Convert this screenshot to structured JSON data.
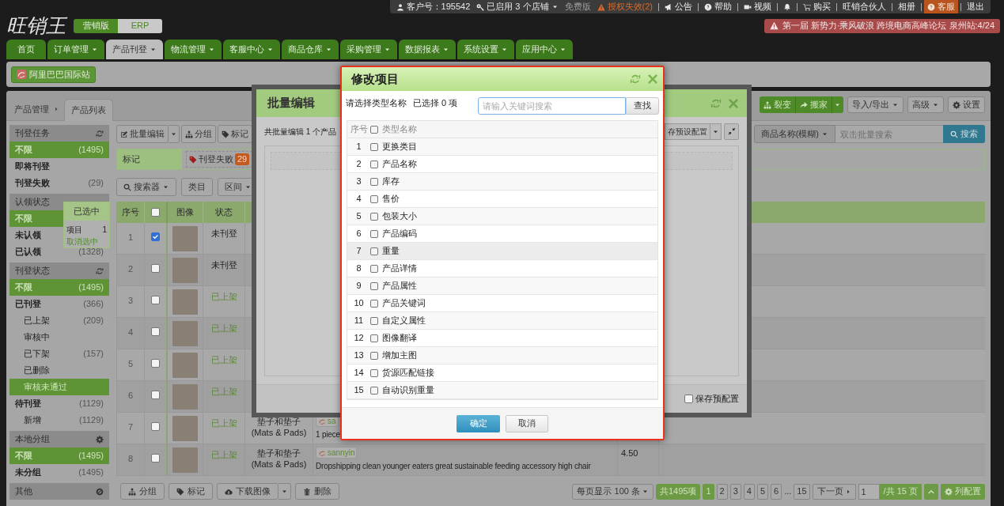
{
  "top_bar": [
    {
      "kind": "customer",
      "text": "客户号：195542"
    },
    {
      "kind": "stores",
      "text": "已启用 3 个店铺"
    },
    {
      "kind": "plan",
      "text": "免费版"
    },
    {
      "kind": "license",
      "text": "授权失效(2)"
    },
    {
      "kind": "notice",
      "text": "公告"
    },
    {
      "kind": "help",
      "text": "帮助"
    },
    {
      "kind": "video",
      "text": "视频"
    },
    {
      "kind": "alerts"
    },
    {
      "kind": "buy",
      "text": "购买"
    },
    {
      "kind": "link",
      "text": "旺销合伙人"
    },
    {
      "kind": "link",
      "text": "相册"
    },
    {
      "kind": "support",
      "text": "客服"
    },
    {
      "kind": "link",
      "text": "退出"
    }
  ],
  "logo": {
    "text": "旺销王"
  },
  "edition_toggle": [
    {
      "label": "营销版",
      "selected": true
    },
    {
      "label": "ERP",
      "selected": false
    }
  ],
  "banner": {
    "text": "第一届 新势力·乘风破浪 跨境电商高峰论坛 泉州站:4/24"
  },
  "nav_tabs": [
    {
      "label": "首页",
      "dropdown": false,
      "selected": false
    },
    {
      "label": "订单管理",
      "dropdown": true,
      "selected": false
    },
    {
      "label": "产品刊登",
      "dropdown": true,
      "selected": true
    },
    {
      "label": "物流管理",
      "dropdown": true,
      "selected": false
    },
    {
      "label": "客服中心",
      "dropdown": true,
      "selected": false
    },
    {
      "label": "商品仓库",
      "dropdown": true,
      "selected": false
    },
    {
      "label": "采购管理",
      "dropdown": true,
      "selected": false
    },
    {
      "label": "数据报表",
      "dropdown": true,
      "selected": false
    },
    {
      "label": "系统设置",
      "dropdown": true,
      "selected": false
    },
    {
      "label": "应用中心",
      "dropdown": true,
      "selected": false
    }
  ],
  "store_button": {
    "label": "阿里巴巴国际站"
  },
  "breadcrumb": {
    "parent": "产品管理",
    "current": "产品列表"
  },
  "right_toolbar": [
    {
      "label": "裂变",
      "kind": "fission"
    },
    {
      "label": "搬家",
      "kind": "move"
    },
    {
      "label": "导入/导出",
      "kind": "menu"
    },
    {
      "label": "高级",
      "kind": "menu"
    },
    {
      "label": "设置",
      "kind": "settings"
    }
  ],
  "sidebar": [
    {
      "title": "刊登任务",
      "kind": "refresh",
      "items": [
        {
          "label": "不限",
          "count": "(1495)",
          "selected": true
        },
        {
          "label": "即将刊登",
          "selected": false
        },
        {
          "label": "刊登失败",
          "count": "(29)",
          "selected": false
        }
      ]
    },
    {
      "title": "认领状态",
      "kind": "plain",
      "items": [
        {
          "label": "不限",
          "selected": true
        },
        {
          "label": "未认领",
          "selected": false
        },
        {
          "label": "已认领",
          "count": "(1328)",
          "selected": false
        }
      ]
    },
    {
      "title": "刊登状态",
      "kind": "refresh",
      "items": [
        {
          "label": "不限",
          "count": "(1495)",
          "selected": true
        },
        {
          "label": "已刊登",
          "count": "(366)",
          "selected": false,
          "children": [
            {
              "label": "已上架",
              "count": "(209)",
              "selected": false
            },
            {
              "label": "审核中",
              "selected": false
            },
            {
              "label": "已下架",
              "count": "(157)",
              "selected": false
            },
            {
              "label": "已删除",
              "selected": false
            },
            {
              "label": "审核未通过",
              "selected": true
            }
          ]
        },
        {
          "label": "待刊登",
          "count": "(1129)",
          "selected": false,
          "children": [
            {
              "label": "新增",
              "count": "(1129)",
              "selected": false
            }
          ]
        }
      ]
    },
    {
      "title": "本地分组",
      "kind": "settings",
      "items": [
        {
          "label": "不限",
          "count": "(1495)",
          "selected": true
        },
        {
          "label": "未分组",
          "count": "(1495)",
          "selected": false
        }
      ]
    },
    {
      "title": "其他",
      "kind": "disabled"
    }
  ],
  "selection_popup": {
    "title": "已选中",
    "label": "项目",
    "value": "1",
    "link": "取消选中"
  },
  "left_toolbar": [
    {
      "label": "批量编辑",
      "kind": "edit"
    },
    {
      "label": "分组",
      "kind": "group"
    },
    {
      "label": "标记",
      "kind": "mark"
    }
  ],
  "search": {
    "field": "商品名称(模糊)",
    "placeholder": "双击批量搜索",
    "button": "搜索"
  },
  "mark_row": {
    "label": "标记",
    "tags": [
      {
        "label": "刊登失败",
        "count": "29"
      }
    ]
  },
  "filters": [
    {
      "label": "搜索器",
      "kind": "search"
    },
    {
      "label": "类目",
      "kind": "plain"
    },
    {
      "label": "区间",
      "kind": "menu"
    }
  ],
  "table": {
    "columns": [
      {
        "kind": "text",
        "label": "序号"
      },
      {
        "kind": "checkbox",
        "checked": false
      },
      {
        "kind": "text",
        "label": "图像"
      },
      {
        "kind": "text",
        "label": "状态"
      }
    ],
    "rows": [
      {
        "index": "1",
        "checked": true,
        "status": "未刊登",
        "listed": false
      },
      {
        "index": "2",
        "checked": false,
        "status": "未刊登",
        "listed": false
      },
      {
        "index": "3",
        "checked": false,
        "status": "已上架",
        "listed": true
      },
      {
        "index": "4",
        "checked": false,
        "status": "已上架",
        "listed": true
      },
      {
        "index": "5",
        "checked": false,
        "status": "已上架",
        "listed": true
      },
      {
        "index": "6",
        "checked": false,
        "status": "已上架",
        "listed": true
      },
      {
        "index": "7",
        "checked": false,
        "status": "已上架",
        "listed": true,
        "category": "垫子和垫子(Mats & Pads)",
        "store": "sa",
        "title": "1 piece"
      },
      {
        "index": "8",
        "checked": false,
        "status": "已上架",
        "listed": true,
        "category": "垫子和垫子(Mats & Pads)",
        "store": "sannyin",
        "title": "Dropshipping clean younger eaters great sustainable feeding accessory high chair",
        "price": "4.50"
      }
    ]
  },
  "bottom_toolbar": [
    {
      "label": "分组",
      "kind": "group"
    },
    {
      "label": "标记",
      "kind": "mark"
    },
    {
      "label": "下载图像",
      "kind": "download"
    },
    {
      "label": "删除",
      "kind": "delete"
    }
  ],
  "pagination": {
    "per_page": "每页显示 100 条",
    "total": "共1495项",
    "pages": [
      {
        "label": "1",
        "selected": true
      },
      {
        "label": "2",
        "selected": false
      },
      {
        "label": "3",
        "selected": false
      },
      {
        "label": "4",
        "selected": false
      },
      {
        "label": "5",
        "selected": false
      },
      {
        "label": "6",
        "selected": false
      }
    ],
    "ellipsis": "...",
    "last": "15",
    "next": "下一页",
    "page_input": "1",
    "page_count": "/共 15 页",
    "columns_button": "列配置"
  },
  "batch_modal": {
    "title": "批量编辑",
    "summary": "共批量编辑 1 个产品",
    "preset_button": "存预设配置",
    "save_preset": {
      "label": "保存预配置",
      "checked": false
    }
  },
  "edit_modal": {
    "title": "修改项目",
    "prompt": "请选择类型名称",
    "selected_count": "已选择 0 项",
    "search_placeholder": "请输入关键词搜索",
    "search_button": "查找",
    "columns": [
      "序号",
      "类型名称"
    ],
    "header_checked": false,
    "items": [
      {
        "index": "1",
        "label": "更换类目",
        "checked": false,
        "highlighted": false
      },
      {
        "index": "2",
        "label": "产品名称",
        "checked": false,
        "highlighted": false
      },
      {
        "index": "3",
        "label": "库存",
        "checked": false,
        "highlighted": false
      },
      {
        "index": "4",
        "label": "售价",
        "checked": false,
        "highlighted": false
      },
      {
        "index": "5",
        "label": "包装大小",
        "checked": false,
        "highlighted": false
      },
      {
        "index": "6",
        "label": "产品编码",
        "checked": false,
        "highlighted": false
      },
      {
        "index": "7",
        "label": "重量",
        "checked": false,
        "highlighted": true
      },
      {
        "index": "8",
        "label": "产品详情",
        "checked": false,
        "highlighted": false
      },
      {
        "index": "9",
        "label": "产品属性",
        "checked": false,
        "highlighted": false
      },
      {
        "index": "10",
        "label": "产品关键词",
        "checked": false,
        "highlighted": false
      },
      {
        "index": "11",
        "label": "自定义属性",
        "checked": false,
        "highlighted": false
      },
      {
        "index": "12",
        "label": "图像翻译",
        "checked": false,
        "highlighted": false
      },
      {
        "index": "13",
        "label": "增加主图",
        "checked": false,
        "highlighted": false
      },
      {
        "index": "14",
        "label": "货源匹配链接",
        "checked": false,
        "highlighted": false
      },
      {
        "index": "15",
        "label": "自动识别重量",
        "checked": false,
        "highlighted": false
      }
    ],
    "confirm": "确定",
    "cancel": "取消"
  }
}
